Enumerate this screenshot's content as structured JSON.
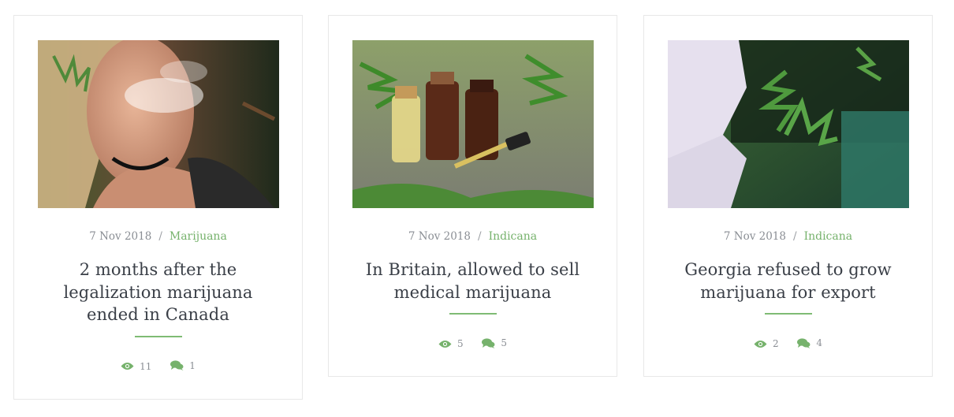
{
  "posts": [
    {
      "image_alt": "woman smoking",
      "date": "7 Nov 2018",
      "separator": "/",
      "category": "Marijuana",
      "title": "2 months after the legalization marijuana ended in Canada",
      "views": "11",
      "comments": "1"
    },
    {
      "image_alt": "cannabis oil bottles",
      "date": "7 Nov 2018",
      "separator": "/",
      "category": "Indicana",
      "title": "In Britain, allowed to sell medical marijuana",
      "views": "5",
      "comments": "5"
    },
    {
      "image_alt": "gloved hands with cannabis plant",
      "date": "7 Nov 2018",
      "separator": "/",
      "category": "Indicana",
      "title": "Georgia refused to grow marijuana for export",
      "views": "2",
      "comments": "4"
    }
  ],
  "icons": {
    "views": "eye-icon",
    "comments": "comments-icon"
  },
  "colors": {
    "accent": "#76b26c",
    "text": "#3a3f47",
    "muted": "#8a8e94",
    "border": "#e8e8e8"
  }
}
